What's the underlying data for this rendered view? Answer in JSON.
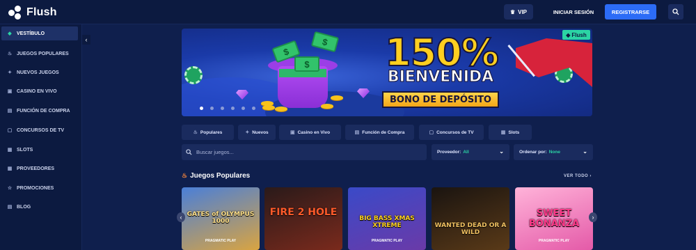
{
  "header": {
    "brand": "Flush",
    "vip_label": "VIP",
    "login_label": "INICIAR SESIÓN",
    "register_label": "REGISTRARSE",
    "icons": {
      "vip": "crown-icon",
      "search": "search-icon"
    }
  },
  "sidebar": {
    "items": [
      {
        "label": "VESTÍBULO",
        "icon": "diamond-icon",
        "active": true
      },
      {
        "label": "JUEGOS POPULARES",
        "icon": "flame-icon"
      },
      {
        "label": "NUEVOS JUEGOS",
        "icon": "sparkle-icon"
      },
      {
        "label": "CASINO EN VIVO",
        "icon": "tv-icon"
      },
      {
        "label": "FUNCIÓN DE COMPRA",
        "icon": "bag-icon"
      },
      {
        "label": "CONCURSOS DE TV",
        "icon": "screen-icon"
      },
      {
        "label": "SLOTS",
        "icon": "slot-icon"
      },
      {
        "label": "PROVEEDORES",
        "icon": "grid-icon"
      },
      {
        "label": "PROMOCIONES",
        "icon": "star-icon"
      },
      {
        "label": "BLOG",
        "icon": "doc-icon"
      }
    ]
  },
  "banner": {
    "headline": "150%",
    "subheadline": "BIENVENIDA",
    "tag": "BONO DE DEPÓSITO",
    "badge": "Flush",
    "slide_count": 6,
    "active_slide": 0
  },
  "categories": [
    {
      "label": "Populares",
      "icon": "flame-icon"
    },
    {
      "label": "Nuevos",
      "icon": "sparkle-icon"
    },
    {
      "label": "Casino en Vivo",
      "icon": "tv-icon"
    },
    {
      "label": "Función de Compra",
      "icon": "bag-icon"
    },
    {
      "label": "Concursos de TV",
      "icon": "screen-icon"
    },
    {
      "label": "Slots",
      "icon": "slot-icon"
    }
  ],
  "filters": {
    "search_placeholder": "Buscar juegos...",
    "provider_label": "Proveedor:",
    "provider_value": "All",
    "order_label": "Ordenar por:",
    "order_value": "None"
  },
  "section": {
    "title": "Juegos Populares",
    "see_all": "VER TODO"
  },
  "games": [
    {
      "title": "GATES of OLYMPUS 1000",
      "provider": "PRAGMATIC PLAY",
      "bg1": "#4a7fd8",
      "bg2": "#d9a441",
      "fg": "#ffe08a"
    },
    {
      "title": "FIRE 2 HOLE",
      "provider": "",
      "bg1": "#2a1a1a",
      "bg2": "#7a2a1c",
      "fg": "#ff5a2a"
    },
    {
      "title": "BIG BASS XMAS XTREME",
      "provider": "PRAGMATIC PLAY",
      "bg1": "#3a4ac8",
      "bg2": "#6a3aa8",
      "fg": "#ffd21f"
    },
    {
      "title": "WANTED DEAD OR A WILD",
      "provider": "",
      "bg1": "#1a1410",
      "bg2": "#5a3a18",
      "fg": "#f0c060"
    },
    {
      "title": "SWEET BONANZA",
      "provider": "PRAGMATIC PLAY",
      "bg1": "#ffb3d9",
      "bg2": "#e45aa8",
      "fg": "#ff3a8a"
    }
  ]
}
